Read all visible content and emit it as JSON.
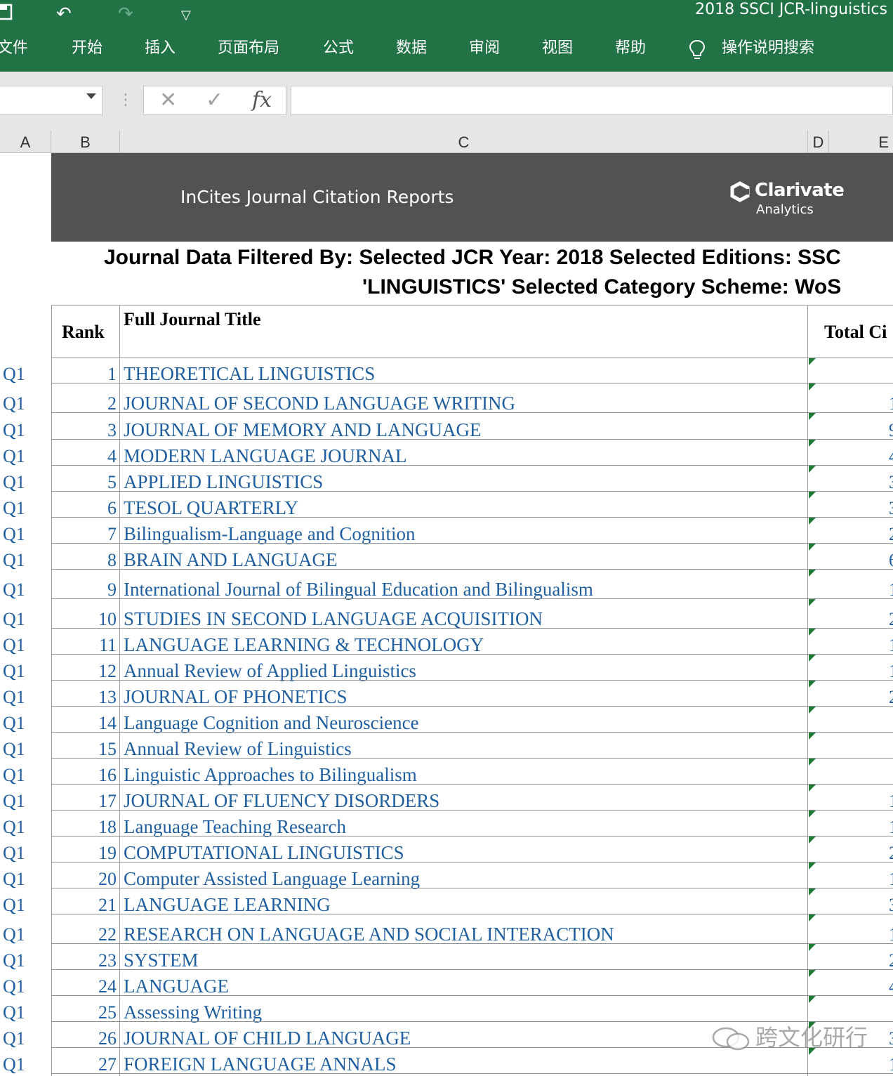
{
  "window": {
    "title": "2018 SSCI JCR-linguistics"
  },
  "ribbon": {
    "tabs": [
      {
        "id": "file",
        "label": "文件"
      },
      {
        "id": "home",
        "label": "开始"
      },
      {
        "id": "insert",
        "label": "插入"
      },
      {
        "id": "page-layout",
        "label": "页面布局"
      },
      {
        "id": "formulas",
        "label": "公式"
      },
      {
        "id": "data",
        "label": "数据"
      },
      {
        "id": "review",
        "label": "审阅"
      },
      {
        "id": "view",
        "label": "视图"
      },
      {
        "id": "help",
        "label": "帮助"
      }
    ],
    "tell_me": "操作说明搜索"
  },
  "formula_bar": {
    "fx_label": "fx",
    "cancel_glyph": "✕",
    "enter_glyph": "✓"
  },
  "columns": [
    "A",
    "B",
    "C",
    "D",
    "E"
  ],
  "banner": {
    "title": "InCites Journal Citation Reports",
    "brand": "Clarivate",
    "brand_sub": "Analytics"
  },
  "filter": {
    "line1": "Journal Data Filtered By:  Selected JCR Year: 2018 Selected Editions: SSC",
    "line2": "'LINGUISTICS' Selected Category Scheme: WoS"
  },
  "table": {
    "headers": {
      "rank": "Rank",
      "title": "Full Journal Title",
      "total_cites": "Total Ci"
    },
    "rows": [
      {
        "quartile": "Q1",
        "rank": "1",
        "title": "THEORETICAL LINGUISTICS",
        "cites": ""
      },
      {
        "quartile": "Q1",
        "rank": "2",
        "title": "JOURNAL OF SECOND LANGUAGE WRITING",
        "cites": "1"
      },
      {
        "quartile": "Q1",
        "rank": "3",
        "title": "JOURNAL OF MEMORY AND LANGUAGE",
        "cites": "9"
      },
      {
        "quartile": "Q1",
        "rank": "4",
        "title": "MODERN LANGUAGE JOURNAL",
        "cites": "4"
      },
      {
        "quartile": "Q1",
        "rank": "5",
        "title": "APPLIED LINGUISTICS",
        "cites": "3"
      },
      {
        "quartile": "Q1",
        "rank": "6",
        "title": "TESOL QUARTERLY",
        "cites": "3"
      },
      {
        "quartile": "Q1",
        "rank": "7",
        "title": "Bilingualism-Language and Cognition",
        "cites": "2"
      },
      {
        "quartile": "Q1",
        "rank": "8",
        "title": "BRAIN AND LANGUAGE",
        "cites": "6"
      },
      {
        "quartile": "Q1",
        "rank": "9",
        "title": "International Journal of Bilingual Education and Bilingualism",
        "cites": "1"
      },
      {
        "quartile": "Q1",
        "rank": "10",
        "title": "STUDIES IN SECOND LANGUAGE ACQUISITION",
        "cites": "2"
      },
      {
        "quartile": "Q1",
        "rank": "11",
        "title": "LANGUAGE LEARNING & TECHNOLOGY",
        "cites": "1"
      },
      {
        "quartile": "Q1",
        "rank": "12",
        "title": "Annual Review of Applied Linguistics",
        "cites": "1"
      },
      {
        "quartile": "Q1",
        "rank": "13",
        "title": "JOURNAL OF PHONETICS",
        "cites": "2"
      },
      {
        "quartile": "Q1",
        "rank": "14",
        "title": "Language Cognition and Neuroscience",
        "cites": ""
      },
      {
        "quartile": "Q1",
        "rank": "15",
        "title": "Annual Review of Linguistics",
        "cites": ""
      },
      {
        "quartile": "Q1",
        "rank": "16",
        "title": "Linguistic Approaches to Bilingualism",
        "cites": ""
      },
      {
        "quartile": "Q1",
        "rank": "17",
        "title": "JOURNAL OF FLUENCY DISORDERS",
        "cites": "1"
      },
      {
        "quartile": "Q1",
        "rank": "18",
        "title": "Language Teaching Research",
        "cites": "1"
      },
      {
        "quartile": "Q1",
        "rank": "19",
        "title": "COMPUTATIONAL LINGUISTICS",
        "cites": "2"
      },
      {
        "quartile": "Q1",
        "rank": "20",
        "title": "Computer Assisted Language Learning",
        "cites": "1"
      },
      {
        "quartile": "Q1",
        "rank": "21",
        "title": "LANGUAGE LEARNING",
        "cites": "3"
      },
      {
        "quartile": "Q1",
        "rank": "22",
        "title": "RESEARCH ON LANGUAGE AND SOCIAL INTERACTION",
        "cites": "1"
      },
      {
        "quartile": "Q1",
        "rank": "23",
        "title": "SYSTEM",
        "cites": "2"
      },
      {
        "quartile": "Q1",
        "rank": "24",
        "title": "LANGUAGE",
        "cites": "4"
      },
      {
        "quartile": "Q1",
        "rank": "25",
        "title": "Assessing Writing",
        "cites": ""
      },
      {
        "quartile": "Q1",
        "rank": "26",
        "title": "JOURNAL OF CHILD LANGUAGE",
        "cites": "3"
      },
      {
        "quartile": "Q1",
        "rank": "27",
        "title": "FOREIGN LANGUAGE ANNALS",
        "cites": "1"
      }
    ]
  },
  "watermark": "跨文化研行",
  "colors": {
    "ribbon": "#217346",
    "banner": "#525252",
    "link_text": "#1f5f9f",
    "error_marker": "#1e7b34"
  }
}
